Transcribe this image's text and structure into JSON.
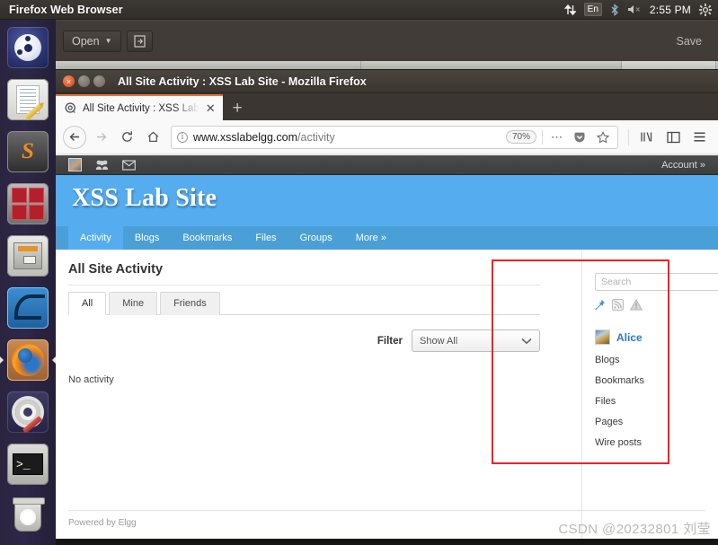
{
  "desktop": {
    "panel": {
      "app_title": "Firefox Web Browser",
      "tray": {
        "network_icon": "network-updown-icon",
        "keyboard_layout": "En",
        "bluetooth_icon": "bluetooth-icon",
        "volume_icon": "volume-muted-icon",
        "clock": "2:55 PM",
        "system_menu_icon": "gear-icon"
      }
    },
    "launcher": {
      "items": [
        {
          "name": "ubuntu-dash",
          "label": "Ubuntu Dash"
        },
        {
          "name": "text-editor",
          "label": "Text Editor"
        },
        {
          "name": "sublime-text",
          "label": "Sublime Text"
        },
        {
          "name": "virtual-machine",
          "label": "Virtual Machine"
        },
        {
          "name": "file-manager",
          "label": "Files"
        },
        {
          "name": "wireshark",
          "label": "Wireshark"
        },
        {
          "name": "firefox",
          "label": "Firefox Web Browser"
        },
        {
          "name": "settings",
          "label": "System Settings"
        },
        {
          "name": "terminal",
          "label": "Terminal"
        },
        {
          "name": "trash",
          "label": "Trash"
        }
      ]
    }
  },
  "gedit_window": {
    "open_label": "Open",
    "open_caret": "▼",
    "new_tab_icon": "new-document-icon",
    "save_label": "Save"
  },
  "firefox": {
    "window_title": "All Site Activity : XSS Lab Site - Mozilla Firefox",
    "controls": {
      "close": "×",
      "minimize": "−",
      "maximize": "□"
    },
    "tab": {
      "title": "All Site Activity : XSS Lab",
      "close_label": "✕",
      "favicon": "elgg-favicon"
    },
    "new_tab_label": "+",
    "toolbar": {
      "back_icon": "back-arrow-icon",
      "forward_icon": "forward-arrow-icon",
      "reload_icon": "reload-icon",
      "home_icon": "home-icon",
      "identity_icon": "info-icon",
      "url_host": "www.xsslabelgg.com",
      "url_path": "/activity",
      "zoom_level": "70%",
      "page_actions_icon": "ellipsis-icon",
      "pocket_icon": "pocket-icon",
      "bookmark_icon": "star-icon",
      "library_icon": "library-icon",
      "sidebar_icon": "sidebar-icon",
      "menu_icon": "hamburger-menu-icon"
    }
  },
  "elgg": {
    "topbar": {
      "avatar_icon": "user-avatar-icon",
      "friends_icon": "friends-icon",
      "messages_icon": "envelope-icon",
      "account_label": "Account »"
    },
    "site_title": "XSS Lab Site",
    "nav": [
      {
        "label": "Activity",
        "active": true
      },
      {
        "label": "Blogs",
        "active": false
      },
      {
        "label": "Bookmarks",
        "active": false
      },
      {
        "label": "Files",
        "active": false
      },
      {
        "label": "Groups",
        "active": false
      },
      {
        "label": "More »",
        "active": false
      }
    ],
    "main": {
      "page_title": "All Site Activity",
      "tabs": [
        {
          "label": "All",
          "active": true
        },
        {
          "label": "Mine",
          "active": false
        },
        {
          "label": "Friends",
          "active": false
        }
      ],
      "filter_label": "Filter",
      "filter_value": "Show All",
      "filter_caret": "⌄",
      "empty_message": "No activity"
    },
    "sidebar": {
      "search_placeholder": "Search",
      "icons": [
        {
          "name": "pin-icon"
        },
        {
          "name": "rss-icon"
        },
        {
          "name": "report-icon"
        }
      ],
      "user_name": "Alice",
      "links": [
        {
          "label": "Blogs"
        },
        {
          "label": "Bookmarks"
        },
        {
          "label": "Files"
        },
        {
          "label": "Pages"
        },
        {
          "label": "Wire posts"
        }
      ]
    },
    "footer": {
      "powered_by": "Powered by Elgg"
    }
  },
  "annotation": {
    "color": "#f52020"
  },
  "watermark": {
    "text": "CSDN @20232801 刘莹"
  }
}
